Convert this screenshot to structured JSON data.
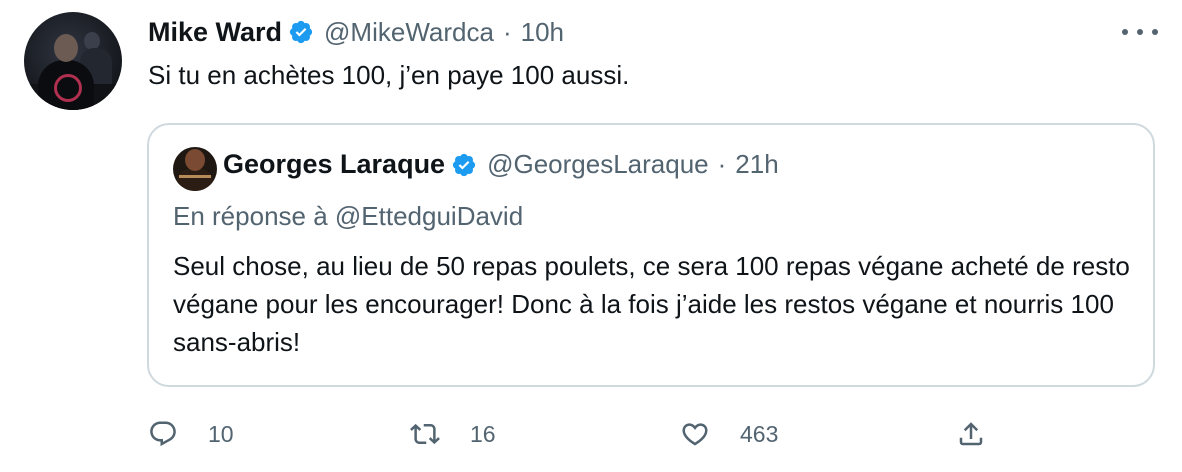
{
  "tweet": {
    "author_name": "Mike Ward",
    "handle": "@MikeWardca",
    "separator": "·",
    "time": "10h",
    "text": "Si tu en achètes 100, j’en paye 100 aussi."
  },
  "quoted_tweet": {
    "author_name": "Georges Laraque",
    "handle": "@GeorgesLaraque",
    "separator": "·",
    "time": "21h",
    "reply_prefix": "En réponse à ",
    "reply_mention": "@EttedguiDavid",
    "text": "Seul chose, au lieu de 50 repas poulets, ce sera 100 repas végane acheté de resto végane pour les encourager! Donc à la fois j’aide les restos végane et nourris 100 sans-abris!"
  },
  "actions": {
    "reply_count": "10",
    "retweet_count": "16",
    "like_count": "463"
  },
  "icons": {
    "verified": "verified-badge-icon",
    "more": "more-options-icon",
    "reply": "reply-icon",
    "retweet": "retweet-icon",
    "like": "heart-icon",
    "share": "share-icon"
  },
  "colors": {
    "verified_blue": "#1d9bf0",
    "secondary_text": "#536471",
    "primary_text": "#0f1419",
    "border": "#cfd9de"
  }
}
